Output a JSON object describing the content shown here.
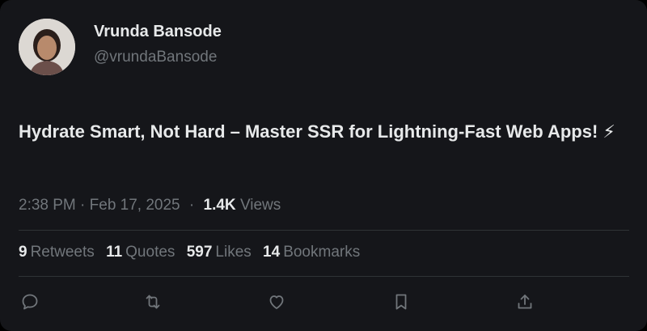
{
  "author": {
    "display_name": "Vrunda Bansode",
    "handle": "@vrundaBansode",
    "avatar_icon": "profile-photo"
  },
  "tweet": {
    "text": "Hydrate Smart, Not Hard – Master SSR for Lightning-Fast Web Apps! ⚡",
    "timestamp": "2:38 PM · Feb 17, 2025",
    "separator": "·",
    "views_count": "1.4K",
    "views_label": "Views"
  },
  "stats": [
    {
      "count": "9",
      "label": "Retweets"
    },
    {
      "count": "11",
      "label": "Quotes"
    },
    {
      "count": "597",
      "label": "Likes"
    },
    {
      "count": "14",
      "label": "Bookmarks"
    }
  ],
  "actions": [
    {
      "icon": "reply-icon"
    },
    {
      "icon": "retweet-icon"
    },
    {
      "icon": "like-icon"
    },
    {
      "icon": "bookmark-icon"
    },
    {
      "icon": "share-icon"
    }
  ],
  "colors": {
    "background": "#15161a",
    "primary_text": "#e7e9ea",
    "secondary_text": "#71767b",
    "divider": "#2f3336"
  }
}
